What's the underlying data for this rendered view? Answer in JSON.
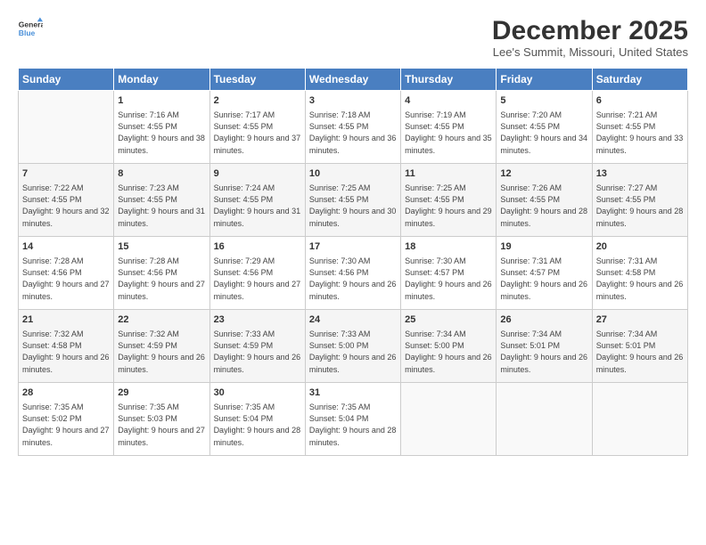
{
  "header": {
    "logo_line1": "General",
    "logo_line2": "Blue",
    "month": "December 2025",
    "location": "Lee's Summit, Missouri, United States"
  },
  "weekdays": [
    "Sunday",
    "Monday",
    "Tuesday",
    "Wednesday",
    "Thursday",
    "Friday",
    "Saturday"
  ],
  "weeks": [
    [
      {
        "day": "",
        "sunrise": "",
        "sunset": "",
        "daylight": ""
      },
      {
        "day": "1",
        "sunrise": "Sunrise: 7:16 AM",
        "sunset": "Sunset: 4:55 PM",
        "daylight": "Daylight: 9 hours and 38 minutes."
      },
      {
        "day": "2",
        "sunrise": "Sunrise: 7:17 AM",
        "sunset": "Sunset: 4:55 PM",
        "daylight": "Daylight: 9 hours and 37 minutes."
      },
      {
        "day": "3",
        "sunrise": "Sunrise: 7:18 AM",
        "sunset": "Sunset: 4:55 PM",
        "daylight": "Daylight: 9 hours and 36 minutes."
      },
      {
        "day": "4",
        "sunrise": "Sunrise: 7:19 AM",
        "sunset": "Sunset: 4:55 PM",
        "daylight": "Daylight: 9 hours and 35 minutes."
      },
      {
        "day": "5",
        "sunrise": "Sunrise: 7:20 AM",
        "sunset": "Sunset: 4:55 PM",
        "daylight": "Daylight: 9 hours and 34 minutes."
      },
      {
        "day": "6",
        "sunrise": "Sunrise: 7:21 AM",
        "sunset": "Sunset: 4:55 PM",
        "daylight": "Daylight: 9 hours and 33 minutes."
      }
    ],
    [
      {
        "day": "7",
        "sunrise": "Sunrise: 7:22 AM",
        "sunset": "Sunset: 4:55 PM",
        "daylight": "Daylight: 9 hours and 32 minutes."
      },
      {
        "day": "8",
        "sunrise": "Sunrise: 7:23 AM",
        "sunset": "Sunset: 4:55 PM",
        "daylight": "Daylight: 9 hours and 31 minutes."
      },
      {
        "day": "9",
        "sunrise": "Sunrise: 7:24 AM",
        "sunset": "Sunset: 4:55 PM",
        "daylight": "Daylight: 9 hours and 31 minutes."
      },
      {
        "day": "10",
        "sunrise": "Sunrise: 7:25 AM",
        "sunset": "Sunset: 4:55 PM",
        "daylight": "Daylight: 9 hours and 30 minutes."
      },
      {
        "day": "11",
        "sunrise": "Sunrise: 7:25 AM",
        "sunset": "Sunset: 4:55 PM",
        "daylight": "Daylight: 9 hours and 29 minutes."
      },
      {
        "day": "12",
        "sunrise": "Sunrise: 7:26 AM",
        "sunset": "Sunset: 4:55 PM",
        "daylight": "Daylight: 9 hours and 28 minutes."
      },
      {
        "day": "13",
        "sunrise": "Sunrise: 7:27 AM",
        "sunset": "Sunset: 4:55 PM",
        "daylight": "Daylight: 9 hours and 28 minutes."
      }
    ],
    [
      {
        "day": "14",
        "sunrise": "Sunrise: 7:28 AM",
        "sunset": "Sunset: 4:56 PM",
        "daylight": "Daylight: 9 hours and 27 minutes."
      },
      {
        "day": "15",
        "sunrise": "Sunrise: 7:28 AM",
        "sunset": "Sunset: 4:56 PM",
        "daylight": "Daylight: 9 hours and 27 minutes."
      },
      {
        "day": "16",
        "sunrise": "Sunrise: 7:29 AM",
        "sunset": "Sunset: 4:56 PM",
        "daylight": "Daylight: 9 hours and 27 minutes."
      },
      {
        "day": "17",
        "sunrise": "Sunrise: 7:30 AM",
        "sunset": "Sunset: 4:56 PM",
        "daylight": "Daylight: 9 hours and 26 minutes."
      },
      {
        "day": "18",
        "sunrise": "Sunrise: 7:30 AM",
        "sunset": "Sunset: 4:57 PM",
        "daylight": "Daylight: 9 hours and 26 minutes."
      },
      {
        "day": "19",
        "sunrise": "Sunrise: 7:31 AM",
        "sunset": "Sunset: 4:57 PM",
        "daylight": "Daylight: 9 hours and 26 minutes."
      },
      {
        "day": "20",
        "sunrise": "Sunrise: 7:31 AM",
        "sunset": "Sunset: 4:58 PM",
        "daylight": "Daylight: 9 hours and 26 minutes."
      }
    ],
    [
      {
        "day": "21",
        "sunrise": "Sunrise: 7:32 AM",
        "sunset": "Sunset: 4:58 PM",
        "daylight": "Daylight: 9 hours and 26 minutes."
      },
      {
        "day": "22",
        "sunrise": "Sunrise: 7:32 AM",
        "sunset": "Sunset: 4:59 PM",
        "daylight": "Daylight: 9 hours and 26 minutes."
      },
      {
        "day": "23",
        "sunrise": "Sunrise: 7:33 AM",
        "sunset": "Sunset: 4:59 PM",
        "daylight": "Daylight: 9 hours and 26 minutes."
      },
      {
        "day": "24",
        "sunrise": "Sunrise: 7:33 AM",
        "sunset": "Sunset: 5:00 PM",
        "daylight": "Daylight: 9 hours and 26 minutes."
      },
      {
        "day": "25",
        "sunrise": "Sunrise: 7:34 AM",
        "sunset": "Sunset: 5:00 PM",
        "daylight": "Daylight: 9 hours and 26 minutes."
      },
      {
        "day": "26",
        "sunrise": "Sunrise: 7:34 AM",
        "sunset": "Sunset: 5:01 PM",
        "daylight": "Daylight: 9 hours and 26 minutes."
      },
      {
        "day": "27",
        "sunrise": "Sunrise: 7:34 AM",
        "sunset": "Sunset: 5:01 PM",
        "daylight": "Daylight: 9 hours and 26 minutes."
      }
    ],
    [
      {
        "day": "28",
        "sunrise": "Sunrise: 7:35 AM",
        "sunset": "Sunset: 5:02 PM",
        "daylight": "Daylight: 9 hours and 27 minutes."
      },
      {
        "day": "29",
        "sunrise": "Sunrise: 7:35 AM",
        "sunset": "Sunset: 5:03 PM",
        "daylight": "Daylight: 9 hours and 27 minutes."
      },
      {
        "day": "30",
        "sunrise": "Sunrise: 7:35 AM",
        "sunset": "Sunset: 5:04 PM",
        "daylight": "Daylight: 9 hours and 28 minutes."
      },
      {
        "day": "31",
        "sunrise": "Sunrise: 7:35 AM",
        "sunset": "Sunset: 5:04 PM",
        "daylight": "Daylight: 9 hours and 28 minutes."
      },
      {
        "day": "",
        "sunrise": "",
        "sunset": "",
        "daylight": ""
      },
      {
        "day": "",
        "sunrise": "",
        "sunset": "",
        "daylight": ""
      },
      {
        "day": "",
        "sunrise": "",
        "sunset": "",
        "daylight": ""
      }
    ]
  ]
}
